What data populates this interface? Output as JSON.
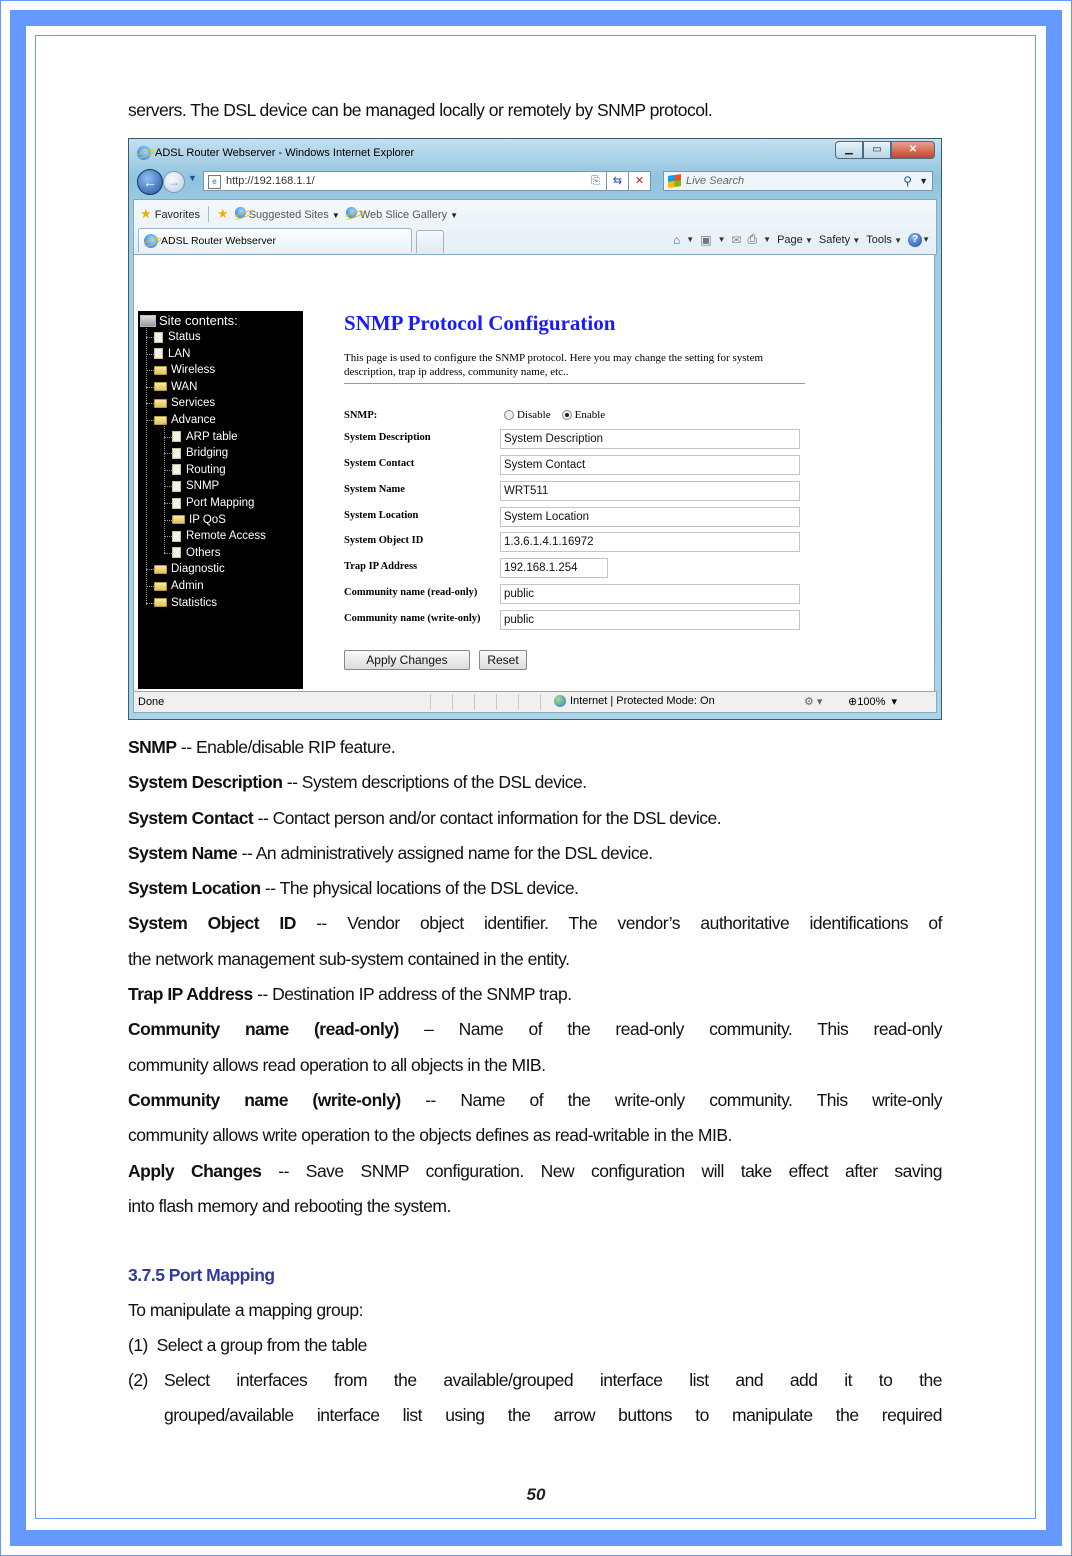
{
  "document": {
    "intro_line": "servers. The DSL device can be managed locally or remotely by SNMP protocol.",
    "descriptions": [
      {
        "term": "SNMP",
        "sep": " -- ",
        "text": "Enable/disable RIP feature."
      },
      {
        "term": "System Description",
        "sep": " -- ",
        "text": "System descriptions of the DSL device."
      },
      {
        "term": "System Contact",
        "sep": " -- ",
        "text": "Contact person and/or contact information for the DSL device."
      },
      {
        "term": "System Name",
        "sep": " -- ",
        "text": "An administratively assigned name for the DSL device."
      },
      {
        "term": "System Location",
        "sep": " -- ",
        "text": "The physical locations of the DSL device."
      },
      {
        "term": "System Object ID",
        "sep": " -- ",
        "text": "Vendor object identifier. The vendor’s authoritative identifications of",
        "cont": "the network management sub-system contained in the entity."
      },
      {
        "term": "Trap IP Address",
        "sep": " -- ",
        "text": "Destination IP address of the SNMP trap."
      },
      {
        "term": "Community name (read-only)",
        "sep": " – ",
        "text": "Name of the read-only community. This read-only",
        "cont": "community allows read operation to all objects in the MIB."
      },
      {
        "term": "Community name (write-only)",
        "sep": " -- ",
        "text": "Name of the write-only community. This write-only",
        "cont": "community allows write operation to the objects defines as read-writable in the MIB."
      },
      {
        "term": "Apply Changes",
        "sep": " -- ",
        "text": "Save SNMP configuration. New configuration will take effect after saving",
        "cont": "into flash memory and rebooting the system."
      }
    ],
    "section_heading": "3.7.5 Port Mapping",
    "section_intro": "To manipulate a mapping group:",
    "steps": [
      {
        "num": "(1)",
        "text": "Select a group from the table"
      },
      {
        "num": "(2)",
        "text": "Select interfaces from the available/grouped interface list and add it to the",
        "cont": "grouped/available interface list using the arrow buttons to manipulate the required"
      }
    ],
    "page_number": "50"
  },
  "browser": {
    "window_title": "ADSL Router Webserver - Windows Internet Explorer",
    "address": "http://192.168.1.1/",
    "search_placeholder": "Live Search",
    "favorites_label": "Favorites",
    "suggested_sites": "Suggested Sites",
    "web_slice_gallery": "Web Slice Gallery",
    "tab_title": "ADSL Router Webserver",
    "menu": {
      "page": "Page",
      "safety": "Safety",
      "tools": "Tools"
    },
    "status": {
      "text": "Done",
      "zone": "Internet | Protected Mode: On",
      "zoom": "100%"
    }
  },
  "router_page": {
    "sidebar": {
      "title": "Site contents:",
      "items": [
        {
          "label": "Status",
          "type": "page",
          "level": 1
        },
        {
          "label": "LAN",
          "type": "page",
          "level": 1
        },
        {
          "label": "Wireless",
          "type": "folder",
          "level": 1
        },
        {
          "label": "WAN",
          "type": "folder",
          "level": 1
        },
        {
          "label": "Services",
          "type": "folder",
          "level": 1
        },
        {
          "label": "Advance",
          "type": "folder-open",
          "level": 1
        },
        {
          "label": "ARP table",
          "type": "page",
          "level": 2
        },
        {
          "label": "Bridging",
          "type": "page",
          "level": 2
        },
        {
          "label": "Routing",
          "type": "page",
          "level": 2
        },
        {
          "label": "SNMP",
          "type": "page",
          "level": 2
        },
        {
          "label": "Port Mapping",
          "type": "page",
          "level": 2
        },
        {
          "label": "IP QoS",
          "type": "folder",
          "level": 2
        },
        {
          "label": "Remote Access",
          "type": "page",
          "level": 2
        },
        {
          "label": "Others",
          "type": "page",
          "level": 2
        },
        {
          "label": "Diagnostic",
          "type": "folder",
          "level": 1
        },
        {
          "label": "Admin",
          "type": "folder",
          "level": 1
        },
        {
          "label": "Statistics",
          "type": "folder",
          "level": 1
        }
      ]
    },
    "title": "SNMP Protocol Configuration",
    "description": "This page is used to configure the SNMP protocol. Here you may change the setting for system description, trap ip address, community name, etc..",
    "snmp": {
      "label": "SNMP:",
      "options": [
        "Disable",
        "Enable"
      ],
      "selected": "Enable"
    },
    "fields": [
      {
        "label": "System Description",
        "value": "System Description"
      },
      {
        "label": "System Contact",
        "value": "System Contact"
      },
      {
        "label": "System Name",
        "value": "WRT511"
      },
      {
        "label": "System Location",
        "value": "System Location"
      },
      {
        "label": "System Object ID",
        "value": "1.3.6.1.4.1.16972"
      },
      {
        "label": "Trap IP Address",
        "value": "192.168.1.254"
      },
      {
        "label": "Community name (read-only)",
        "value": "public"
      },
      {
        "label": "Community name (write-only)",
        "value": "public"
      }
    ],
    "buttons": {
      "apply": "Apply Changes",
      "reset": "Reset"
    }
  },
  "colors": {
    "frame": "#6699ff",
    "heading": "#2e3b9c",
    "page_title": "#1a1aff"
  }
}
